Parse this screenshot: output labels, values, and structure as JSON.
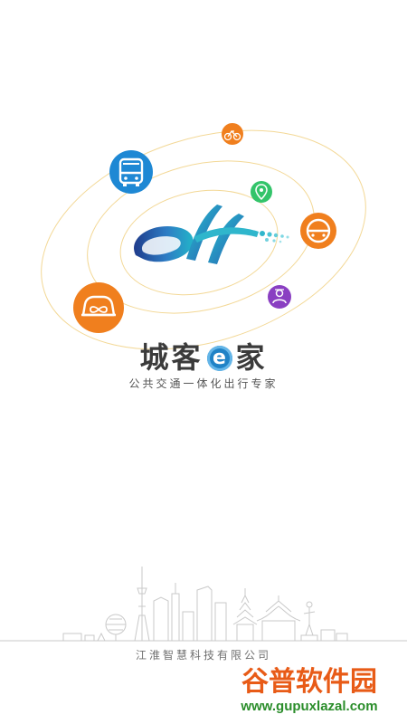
{
  "splash": {
    "app_name_part1": "城客",
    "app_name_badge": "e",
    "app_name_part2": "家",
    "tagline": "公共交通一体化出行专家",
    "company": "江淮智慧科技有限公司"
  },
  "icons": [
    {
      "name": "bicycle-icon",
      "color": "#f07f1e"
    },
    {
      "name": "bus-icon",
      "color": "#1e88d4"
    },
    {
      "name": "location-pin-icon",
      "color": "#33c46a"
    },
    {
      "name": "car-icon",
      "color": "#f07f1e"
    },
    {
      "name": "car-share-icon",
      "color": "#f07f1e"
    },
    {
      "name": "person-pin-icon",
      "color": "#8a3fc2"
    }
  ],
  "colors": {
    "orbit": "#f3d896",
    "logo_dark_blue": "#1f3c8c",
    "logo_teal": "#23b3c9",
    "title_text": "#3b3b3b",
    "accent_blue": "#1f82c6"
  },
  "watermark": {
    "main": "谷普软件园",
    "url": "www.gupuxlazal.com"
  }
}
